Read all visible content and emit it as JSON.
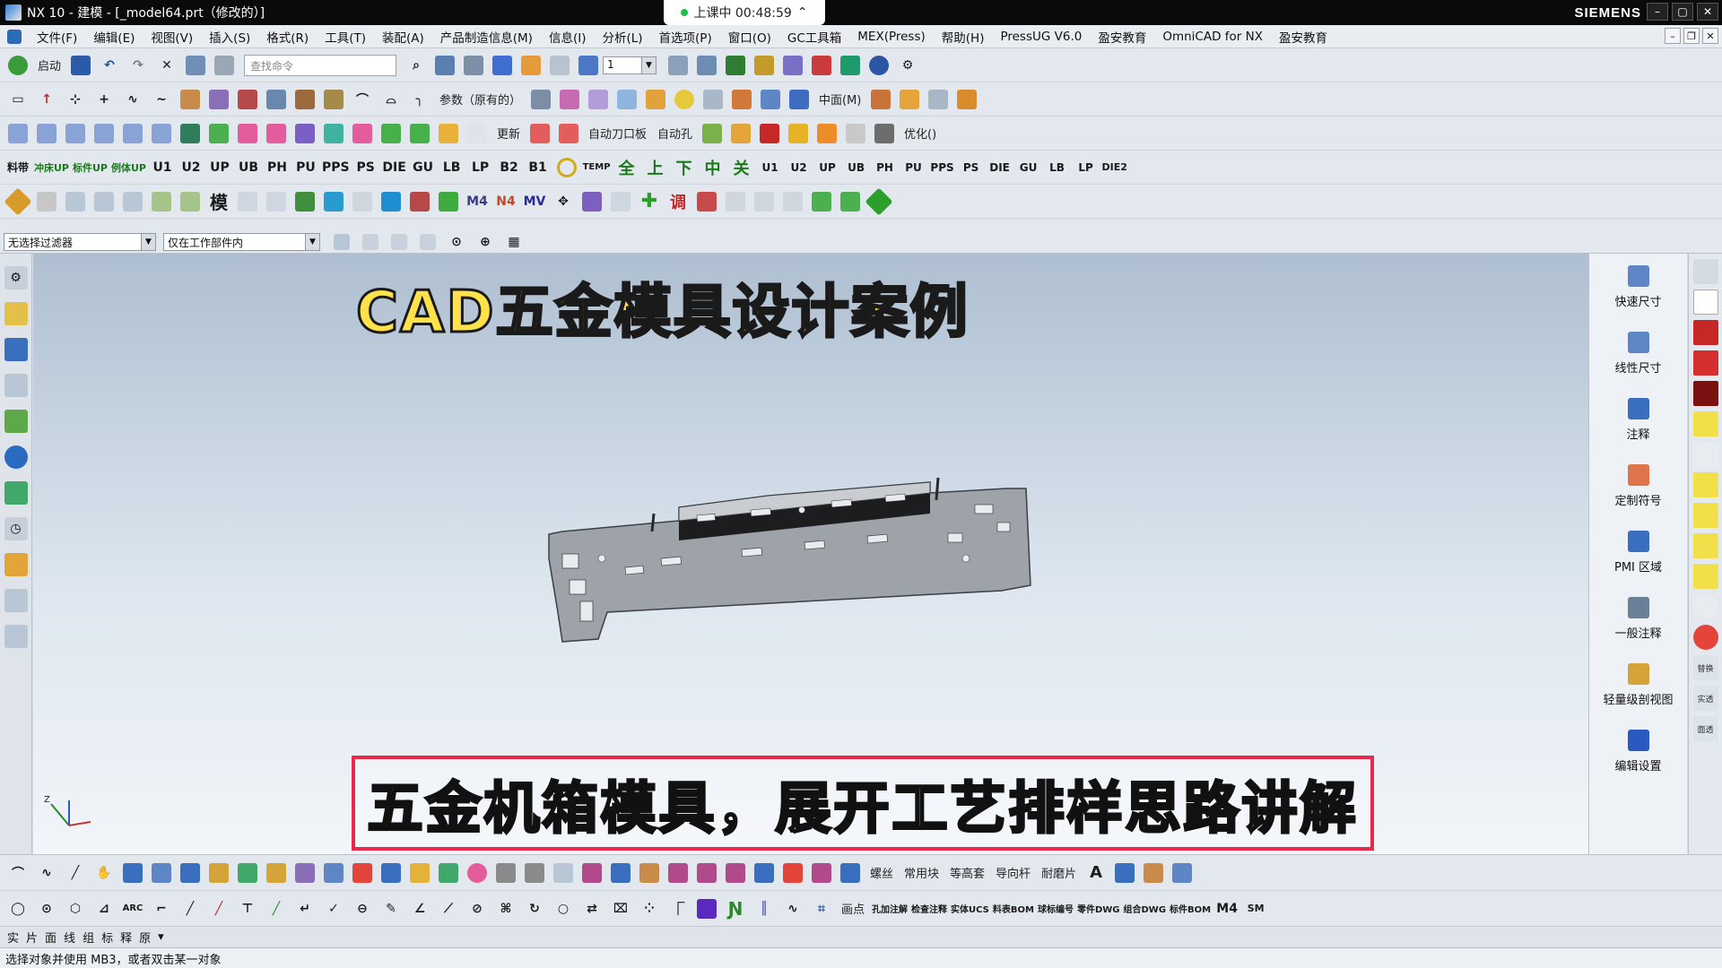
{
  "window": {
    "title": "NX 10 - 建模 - [_model64.prt（修改的）]",
    "brand": "SIEMENS",
    "live_status": "上课中 00:48:59"
  },
  "menu": {
    "items": [
      "文件(F)",
      "编辑(E)",
      "视图(V)",
      "插入(S)",
      "格式(R)",
      "工具(T)",
      "装配(A)",
      "产品制造信息(M)",
      "信息(I)",
      "分析(L)",
      "首选项(P)",
      "窗口(O)",
      "GC工具箱",
      "MEX(Press)",
      "帮助(H)",
      "PressUG V6.0",
      "盈安教育",
      "OmniCAD for NX",
      "盈安教育"
    ]
  },
  "toolbar": {
    "start_label": "启动",
    "search_placeholder": "查找命令",
    "layer_value": "1",
    "param_label": "参数（原有的）",
    "auto_knife_label": "自动刀口板",
    "auto_hole_label": "自动孔",
    "middle_label": "中面(M)",
    "optimize_label": "优化()",
    "update_label": "更新",
    "die_codes": [
      "料带",
      "冲床UP",
      "标件UP",
      "例体UP",
      "U1",
      "U2",
      "UP",
      "UB",
      "PH",
      "PU",
      "PPS",
      "PS",
      "DIE",
      "GU",
      "LB",
      "LP",
      "B2",
      "B1"
    ],
    "die_codes_right": [
      "U1",
      "U2",
      "UP",
      "UB",
      "PH",
      "PU",
      "PPS",
      "PS",
      "DIE",
      "GU",
      "LB",
      "LP"
    ],
    "die2_label": "DIE2",
    "temp_label": "TEMP",
    "chars": [
      "全",
      "上",
      "下",
      "中",
      "关"
    ],
    "row5_labels": [
      "模",
      "M4",
      "N4",
      "MV",
      "调"
    ],
    "more_labels": [
      "螺丝",
      "常用块",
      "等高套",
      "导向杆",
      "耐磨片"
    ]
  },
  "filter": {
    "selection_filter": "无选择过滤器",
    "scope": "仅在工作部件内"
  },
  "viewport": {
    "overlay_title": "CAD五金模具设计案例",
    "subtitle": "五金机箱模具，展开工艺排样思路讲解",
    "axis_label": "Z"
  },
  "right_palette": {
    "items": [
      "快速尺寸",
      "线性尺寸",
      "注释",
      "定制符号",
      "PMI 区域",
      "一般注释",
      "轻量级剖视图",
      "编辑设置"
    ]
  },
  "far_right": {
    "items": [
      "替换",
      "实透",
      "面透"
    ]
  },
  "bottom": {
    "point_label": "画点",
    "tags": [
      "孔加注解",
      "检查注释",
      "实体UCS",
      "料表BOM",
      "球标编号",
      "零件DWG",
      "组合DWG",
      "标件BOM",
      "M4",
      "SM"
    ]
  },
  "selection_row": [
    "实",
    "片",
    "面",
    "线",
    "组",
    "标",
    "释",
    "原"
  ],
  "status": {
    "text": "选择对象并使用 MB3，或者双击某一对象"
  },
  "colors": {
    "title_yellow": "#ffe24a",
    "subtitle_border": "#e8294a",
    "titlebar_bg": "#0a0a0a"
  }
}
